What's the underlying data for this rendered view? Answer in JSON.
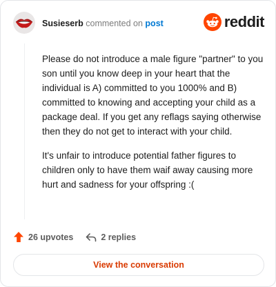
{
  "header": {
    "username": "Susieserb",
    "commented_text": "commented on",
    "post_link": "post",
    "brand_name": "reddit"
  },
  "comment": {
    "paragraphs": [
      "Please do not introduce a male figure \"partner\" to you son until you know deep in your heart that the individual is A) committed to you 1000% and B) committed to knowing and accepting your child as a package deal. If you get any reflags saying otherwise then they do not get to interact with your child.",
      "It's unfair to introduce potential father figures to children only to have them waif away causing more hurt and sadness for your offspring :("
    ]
  },
  "actions": {
    "upvotes": "26 upvotes",
    "replies": "2 replies"
  },
  "cta": {
    "label": "View the conversation"
  },
  "colors": {
    "accent": "#d93a00",
    "brand_orange": "#ff4500",
    "link_blue": "#0079d3",
    "muted": "#7c7c7c"
  },
  "icons": {
    "upvote": "upvote-arrow-icon",
    "reply": "reply-arrow-icon",
    "brand": "reddit-snoo-icon"
  }
}
